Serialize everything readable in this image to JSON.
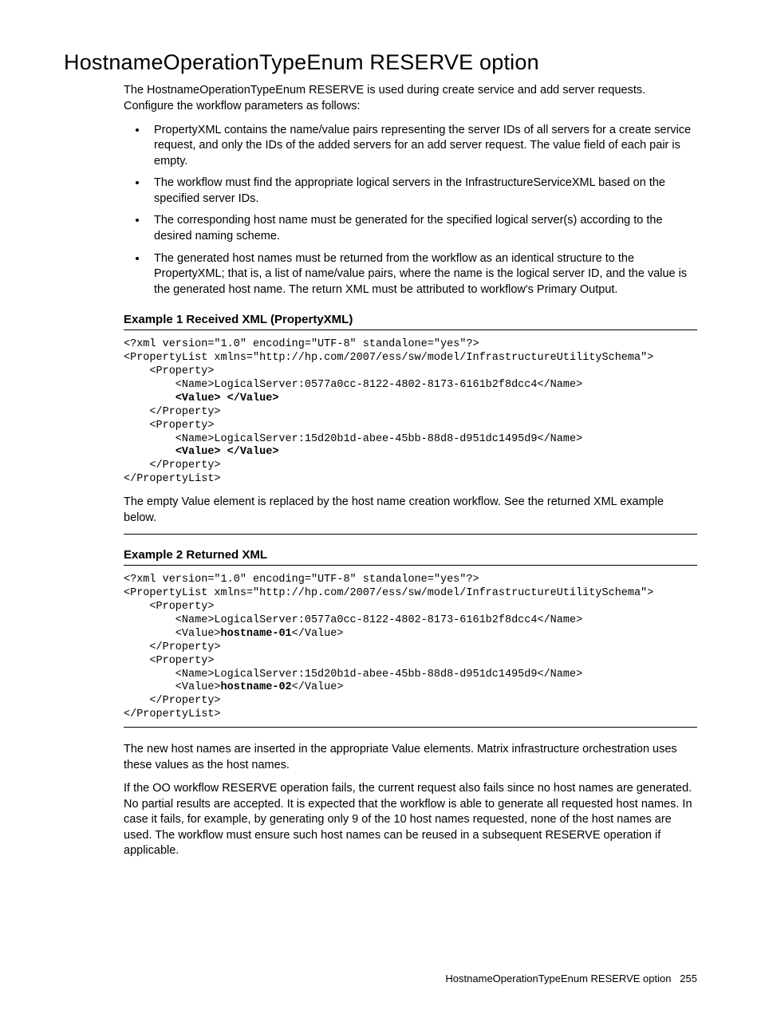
{
  "heading": "HostnameOperationTypeEnum RESERVE option",
  "intro": "The HostnameOperationTypeEnum RESERVE is used during create service and add server requests. Configure the workflow parameters as follows:",
  "bullets": [
    "PropertyXML contains the name/value pairs representing the server IDs of all servers for a create service request, and only the IDs of the added servers for an add server request. The value field of each pair is empty.",
    "The workflow must find the appropriate logical servers in the InfrastructureServiceXML based on the specified server IDs.",
    "The corresponding host name must be generated for the specified logical server(s) according to the desired naming scheme.",
    "The generated host names must be returned from the workflow as an identical structure to the PropertyXML; that is, a list of name/value pairs, where the name is the logical server ID, and the value is the generated host name. The return XML must be attributed to workflow's Primary Output."
  ],
  "example1": {
    "title": "Example 1 Received XML (PropertyXML)",
    "code_lines": [
      {
        "t": "<?xml version=\"1.0\" encoding=\"UTF-8\" standalone=\"yes\"?>"
      },
      {
        "t": "<PropertyList xmlns=\"http://hp.com/2007/ess/sw/model/InfrastructureUtilitySchema\">"
      },
      {
        "t": "    <Property>"
      },
      {
        "t": "        <Name>LogicalServer:0577a0cc-8122-4802-8173-6161b2f8dcc4</Name>"
      },
      {
        "t": "        ",
        "b": "<Value> </Value>"
      },
      {
        "t": "    </Property>"
      },
      {
        "t": "    <Property>"
      },
      {
        "t": "        <Name>LogicalServer:15d20b1d-abee-45bb-88d8-d951dc1495d9</Name>"
      },
      {
        "t": "        ",
        "b": "<Value> </Value>"
      },
      {
        "t": "    </Property>"
      },
      {
        "t": "</PropertyList>"
      }
    ],
    "after": "The empty Value element is replaced by the host name creation workflow. See the returned XML example below."
  },
  "example2": {
    "title": "Example 2 Returned XML",
    "code_lines": [
      {
        "t": "<?xml version=\"1.0\" encoding=\"UTF-8\" standalone=\"yes\"?>"
      },
      {
        "t": "<PropertyList xmlns=\"http://hp.com/2007/ess/sw/model/InfrastructureUtilitySchema\">"
      },
      {
        "t": "    <Property>"
      },
      {
        "t": "        <Name>LogicalServer:0577a0cc-8122-4802-8173-6161b2f8dcc4</Name>"
      },
      {
        "t": "        <Value>",
        "b": "hostname-01",
        "a": "</Value>"
      },
      {
        "t": "    </Property>"
      },
      {
        "t": "    <Property>"
      },
      {
        "t": "        <Name>LogicalServer:15d20b1d-abee-45bb-88d8-d951dc1495d9</Name>"
      },
      {
        "t": "        <Value>",
        "b": "hostname-02",
        "a": "</Value>"
      },
      {
        "t": "    </Property>"
      },
      {
        "t": "</PropertyList>"
      }
    ]
  },
  "para1": "The new host names are inserted in the appropriate Value elements. Matrix infrastructure orchestration uses these values as the host names.",
  "para2": "If the OO workflow RESERVE operation fails, the current request also fails since no host names are generated. No partial results are accepted. It is expected that the workflow is able to generate all requested host names. In case it fails, for example, by generating only 9 of the 10 host names requested, none of the host names are used. The workflow must ensure such host names can be reused in a subsequent RESERVE operation if applicable.",
  "footer_text": "HostnameOperationTypeEnum RESERVE option",
  "footer_page": "255"
}
